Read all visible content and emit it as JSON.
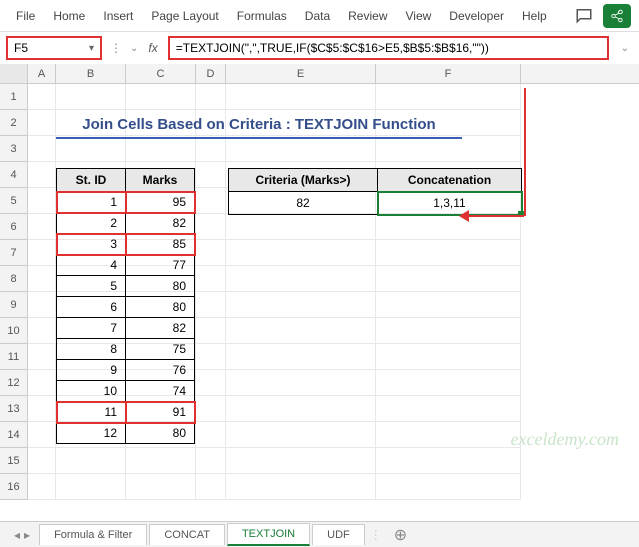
{
  "ribbon": {
    "items": [
      "File",
      "Home",
      "Insert",
      "Page Layout",
      "Formulas",
      "Data",
      "Review",
      "View",
      "Developer",
      "Help"
    ]
  },
  "namebox": {
    "value": "F5"
  },
  "formula": {
    "value": "=TEXTJOIN(\",\",TRUE,IF($C$5:$C$16>E5,$B$5:$B$16,\"\"))"
  },
  "columns": [
    "A",
    "B",
    "C",
    "D",
    "E",
    "F"
  ],
  "rownums": [
    "1",
    "2",
    "3",
    "4",
    "5",
    "6",
    "7",
    "8",
    "9",
    "10",
    "11",
    "12",
    "13",
    "14",
    "15",
    "16"
  ],
  "title": "Join Cells Based on Criteria : TEXTJOIN Function",
  "student_table": {
    "headers": [
      "St. ID",
      "Marks"
    ],
    "rows": [
      {
        "id": "1",
        "marks": "95",
        "hl": true
      },
      {
        "id": "2",
        "marks": "82",
        "hl": false
      },
      {
        "id": "3",
        "marks": "85",
        "hl": true
      },
      {
        "id": "4",
        "marks": "77",
        "hl": false
      },
      {
        "id": "5",
        "marks": "80",
        "hl": false
      },
      {
        "id": "6",
        "marks": "80",
        "hl": false
      },
      {
        "id": "7",
        "marks": "82",
        "hl": false
      },
      {
        "id": "8",
        "marks": "75",
        "hl": false
      },
      {
        "id": "9",
        "marks": "76",
        "hl": false
      },
      {
        "id": "10",
        "marks": "74",
        "hl": false
      },
      {
        "id": "11",
        "marks": "91",
        "hl": true
      },
      {
        "id": "12",
        "marks": "80",
        "hl": false
      }
    ]
  },
  "criteria_table": {
    "headers": [
      "Criteria (Marks>)",
      "Concatenation"
    ],
    "row": {
      "criteria": "82",
      "result": "1,3,11"
    }
  },
  "watermark": "exceldemy.com",
  "sheet_tabs": {
    "items": [
      "Formula & Filter",
      "CONCAT",
      "TEXTJOIN",
      "UDF"
    ],
    "active": 2
  }
}
